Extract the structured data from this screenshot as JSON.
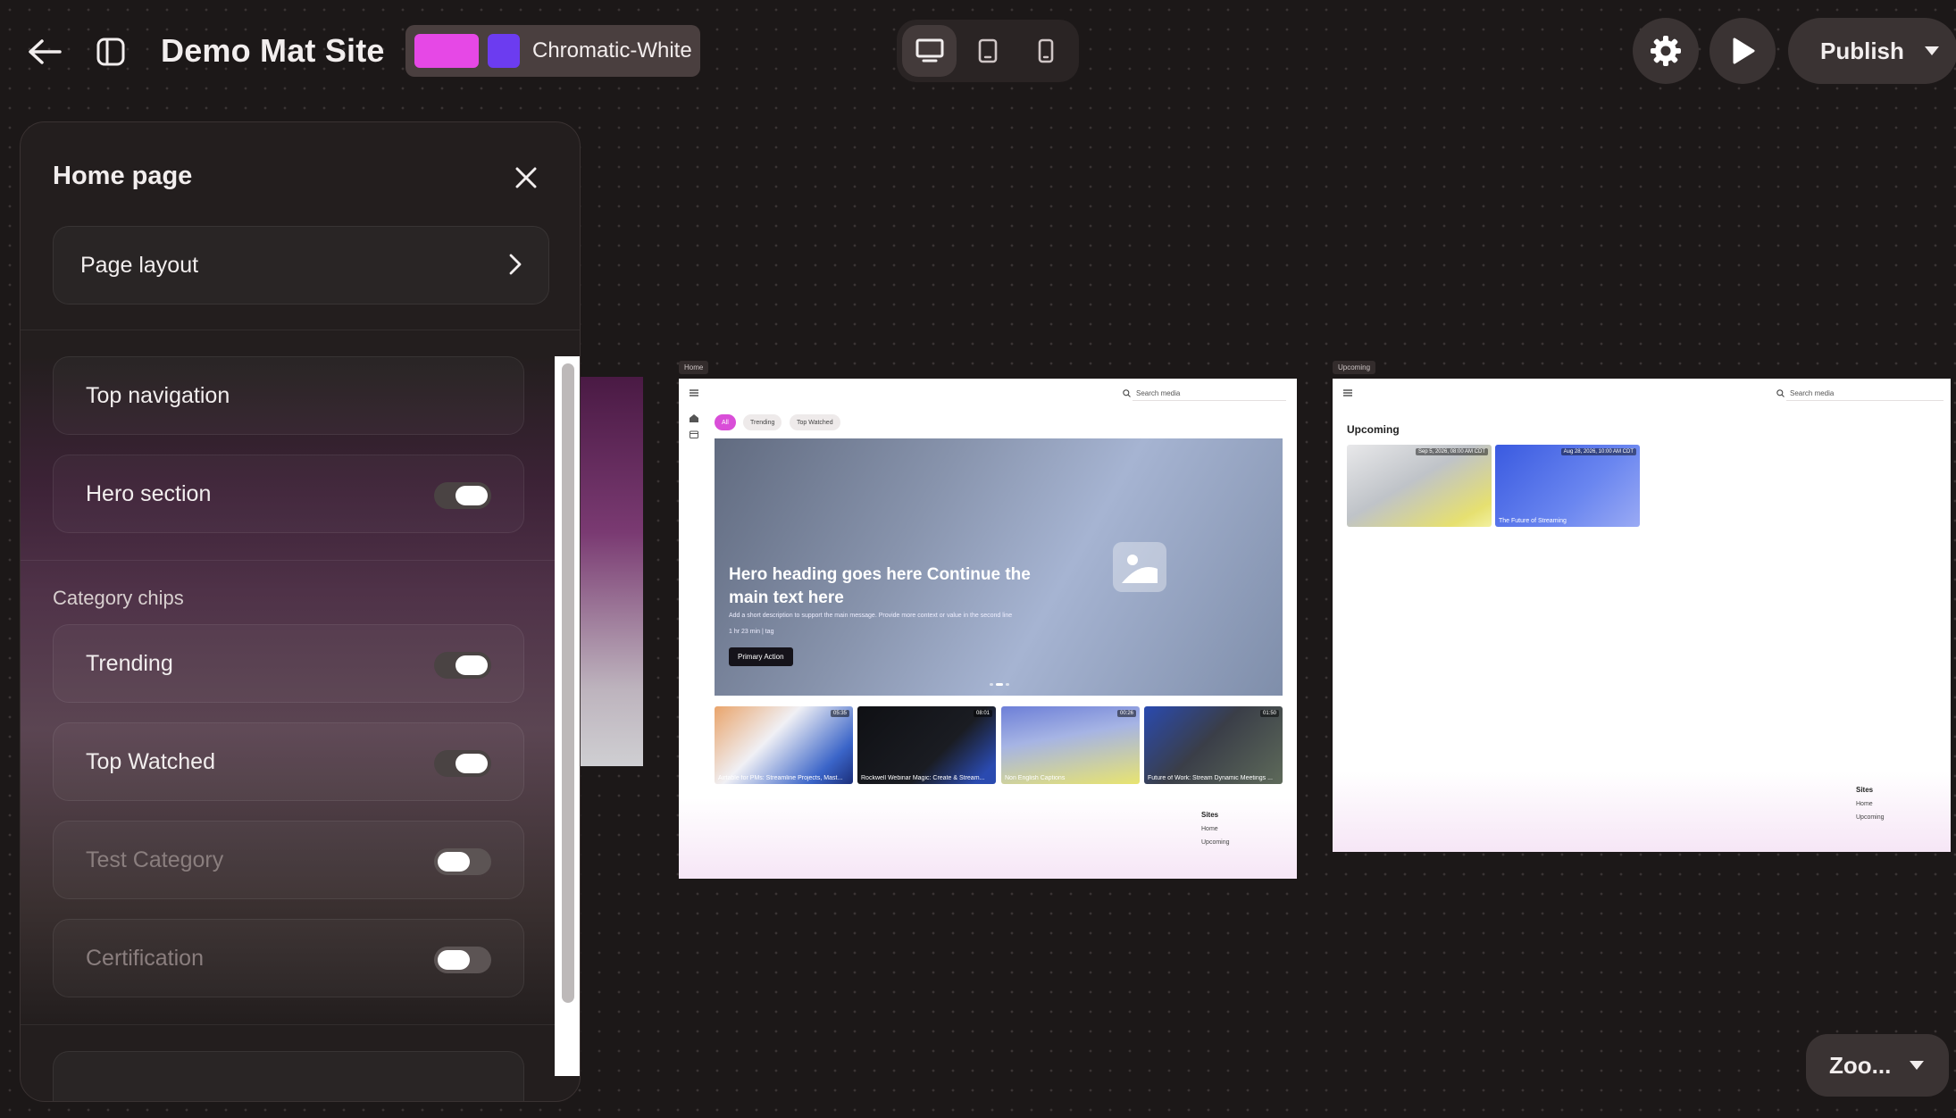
{
  "topbar": {
    "site_title": "Demo Mat Site",
    "theme_name": "Chromatic-White",
    "theme_colors": [
      "#e648e6",
      "#6c3cf0"
    ],
    "publish_label": "Publish",
    "zoom_label": "Zoo..."
  },
  "panel": {
    "title": "Home page",
    "page_layout": "Page layout",
    "top_navigation": "Top navigation",
    "hero_section": "Hero section",
    "category_chips_label": "Category chips",
    "chips": [
      {
        "label": "Trending",
        "on": true
      },
      {
        "label": "Top Watched",
        "on": true
      },
      {
        "label": "Test Category",
        "on": false
      },
      {
        "label": "Certification",
        "on": false
      }
    ]
  },
  "home": {
    "tag": "Home",
    "search_placeholder": "Search media",
    "chips": [
      "All",
      "Trending",
      "Top Watched"
    ],
    "hero_heading": "Hero heading goes here Continue the main text here",
    "hero_desc": "Add a short description to support the main message. Provide more context or value in the second line",
    "hero_meta": "1 hr 23 min  |  tag",
    "hero_cta": "Primary Action",
    "videos": [
      {
        "title": "Airtable for PMs: Streamline Projects, Mast...",
        "duration": "05:35"
      },
      {
        "title": "Rockwell Webinar Magic: Create & Stream...",
        "duration": "08:01"
      },
      {
        "title": "Non English Captions",
        "duration": "00:26"
      },
      {
        "title": "Future of Work: Stream Dynamic Meetings ...",
        "duration": "01:50"
      }
    ],
    "footer_head": "Sites",
    "footer_links": [
      "Home",
      "Upcoming"
    ]
  },
  "upcoming": {
    "tag": "Upcoming",
    "search_placeholder": "Search media",
    "heading": "Upcoming",
    "events": [
      {
        "title": "",
        "date": "Sep 5, 2026, 08:00 AM CDT"
      },
      {
        "title": "The Future of Streaming",
        "date": "Aug 28, 2026, 10:00 AM CDT"
      }
    ],
    "footer_head": "Sites",
    "footer_links": [
      "Home",
      "Upcoming"
    ]
  }
}
